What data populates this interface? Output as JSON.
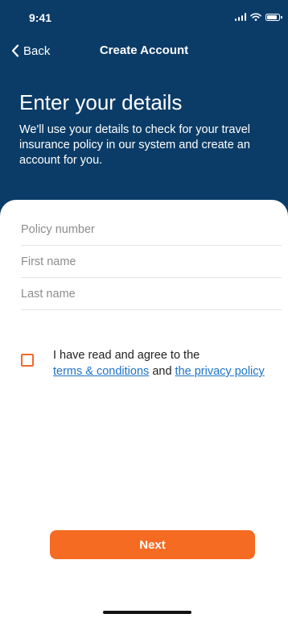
{
  "status_bar": {
    "time": "9:41"
  },
  "nav": {
    "back_label": "Back",
    "title": "Create Account"
  },
  "header": {
    "title": "Enter your details",
    "subtitle": "We'll use your details to check for your travel insurance policy in our system and create an account for you."
  },
  "form": {
    "policy_number": {
      "value": "",
      "placeholder": "Policy number"
    },
    "first_name": {
      "value": "",
      "placeholder": "First name"
    },
    "last_name": {
      "value": "",
      "placeholder": "Last name"
    }
  },
  "consent": {
    "checked": false,
    "text_prefix": "I have read and agree to the",
    "terms_link": "terms & conditions",
    "joiner": "and",
    "privacy_link": "the privacy policy"
  },
  "actions": {
    "next_label": "Next"
  },
  "colors": {
    "header_bg": "#0b3c67",
    "accent": "#f56b22",
    "link": "#1e73c7"
  },
  "icons": {
    "back": "chevron-left-icon",
    "signal": "cellular-signal-icon",
    "wifi": "wifi-icon",
    "battery": "battery-icon"
  }
}
